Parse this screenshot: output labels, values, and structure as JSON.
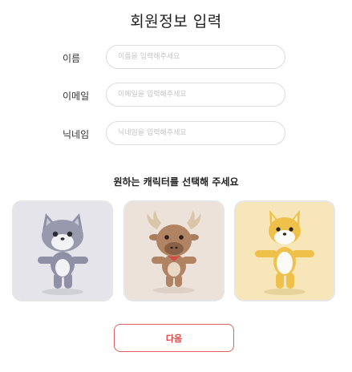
{
  "page": {
    "title": "회원정보 입력"
  },
  "form": {
    "fields": [
      {
        "label": "이름",
        "placeholder": "이름을 입력해주세요",
        "value": ""
      },
      {
        "label": "이메일",
        "placeholder": "이메일을 입력해주세요",
        "value": ""
      },
      {
        "label": "닉네임",
        "placeholder": "닉네임을 입력해주세요",
        "value": ""
      }
    ]
  },
  "character_section": {
    "heading": "원하는 캐릭터를 선택해 주세요",
    "characters": [
      {
        "icon": "cat-character-icon",
        "background": "#e4e4ea"
      },
      {
        "icon": "moose-character-icon",
        "background": "#ece2da"
      },
      {
        "icon": "shiba-dog-character-icon",
        "background": "#f6e6b9"
      }
    ]
  },
  "actions": {
    "next_label": "다음",
    "accent_color": "#e04646"
  }
}
